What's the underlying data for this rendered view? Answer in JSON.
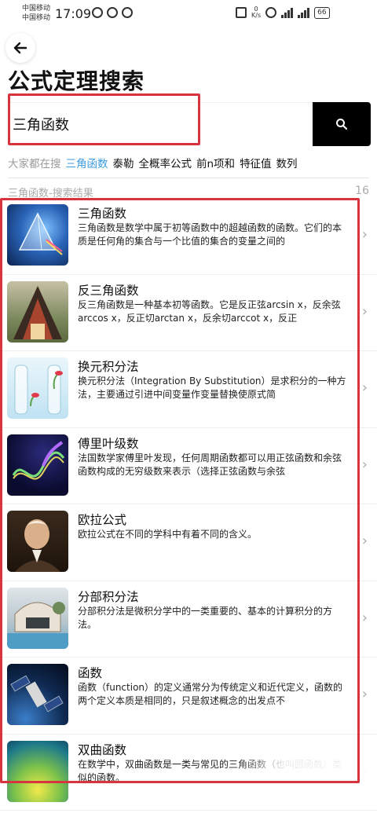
{
  "status_bar": {
    "carrier1": "中国移动",
    "carrier2": "中国移动",
    "time": "17:09",
    "net_speed_value": "0",
    "net_speed_unit": "K/s",
    "battery": "66"
  },
  "header": {
    "title": "公式定理搜索"
  },
  "search": {
    "value": "三角函数"
  },
  "hot": {
    "label": "大家都在搜",
    "tags": [
      "三角函数",
      "泰勒",
      "全概率公式",
      "前n项和",
      "特征值",
      "数列"
    ]
  },
  "results": {
    "title": "三角函数-搜索结果",
    "count": "16",
    "items": [
      {
        "title": "三角函数",
        "desc": "三角函数是数学中属于初等函数中的超越函数的函数。它们的本质是任何角的集合与一个比值的集合的变量之间的"
      },
      {
        "title": "反三角函数",
        "desc": "反三角函数是一种基本初等函数。它是反正弦arcsin x，反余弦arccos x，反正切arctan x，反余切arccot x，反正"
      },
      {
        "title": "换元积分法",
        "desc": "换元积分法（Integration By Substitution）是求积分的一种方法，主要通过引进中间变量作变量替换使原式简"
      },
      {
        "title": "傅里叶级数",
        "desc": "法国数学家傅里叶发现，任何周期函数都可以用正弦函数和余弦函数构成的无穷级数来表示（选择正弦函数与余弦"
      },
      {
        "title": "欧拉公式",
        "desc": "欧拉公式在不同的学科中有着不同的含义。"
      },
      {
        "title": "分部积分法",
        "desc": "分部积分法是微积分学中的一类重要的、基本的计算积分的方法。"
      },
      {
        "title": "函数",
        "desc": "函数（function）的定义通常分为传统定义和近代定义，函数的两个定义本质是相同的，只是叙述概念的出发点不"
      },
      {
        "title": "双曲函数",
        "desc": "在数学中，双曲函数是一类与常见的三角函数（也叫圆函数）类似的函数。"
      }
    ]
  },
  "colors": {
    "accent_blue": "#3a9be0",
    "highlight_red": "#d9333f",
    "search_button": "#000000"
  }
}
